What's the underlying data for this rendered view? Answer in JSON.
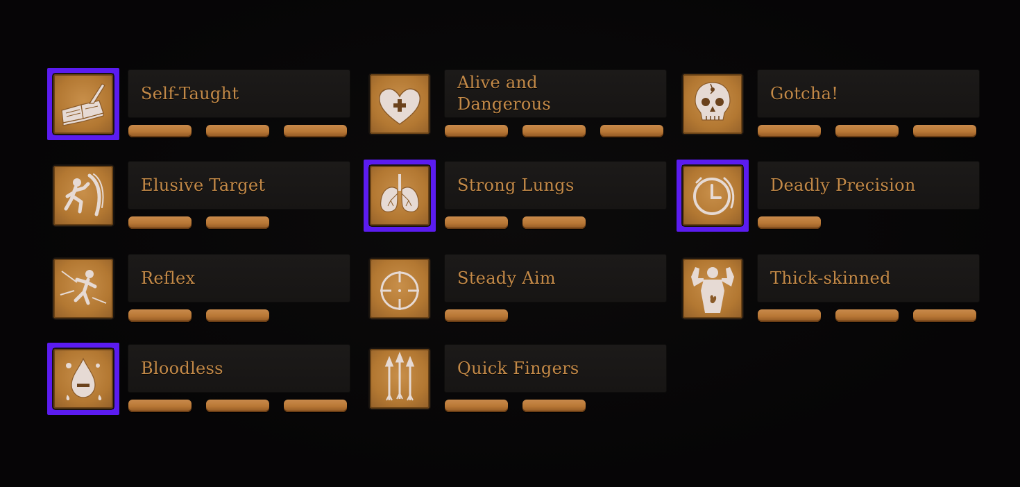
{
  "theme": {
    "accent_selected": "#5b1cf0",
    "title_color": "#c48a48",
    "pip_color": "#b87735",
    "icon_bg": "#b37832",
    "icon_glyph": "#e8dcd6"
  },
  "perks": [
    {
      "title": "Self-Taught",
      "icon": "book-quill-icon",
      "selected": true,
      "pips": 3
    },
    {
      "title": "Alive and\nDangerous",
      "icon": "heart-plus-icon",
      "selected": false,
      "pips": 3
    },
    {
      "title": "Gotcha!",
      "icon": "skull-icon",
      "selected": false,
      "pips": 3
    },
    {
      "title": "Elusive Target",
      "icon": "dodge-figure-icon",
      "selected": false,
      "pips": 2
    },
    {
      "title": "Strong Lungs",
      "icon": "lungs-icon",
      "selected": true,
      "pips": 2
    },
    {
      "title": "Deadly Precision",
      "icon": "stopwatch-icon",
      "selected": true,
      "pips": 1
    },
    {
      "title": "Reflex",
      "icon": "reflex-figure-icon",
      "selected": false,
      "pips": 2
    },
    {
      "title": "Steady Aim",
      "icon": "crosshair-icon",
      "selected": false,
      "pips": 1
    },
    {
      "title": "Thick-skinned",
      "icon": "flexing-torso-icon",
      "selected": false,
      "pips": 3
    },
    {
      "title": "Bloodless",
      "icon": "blood-drop-minus-icon",
      "selected": true,
      "pips": 3
    },
    {
      "title": "Quick Fingers",
      "icon": "arrows-icon",
      "selected": false,
      "pips": 2
    }
  ]
}
